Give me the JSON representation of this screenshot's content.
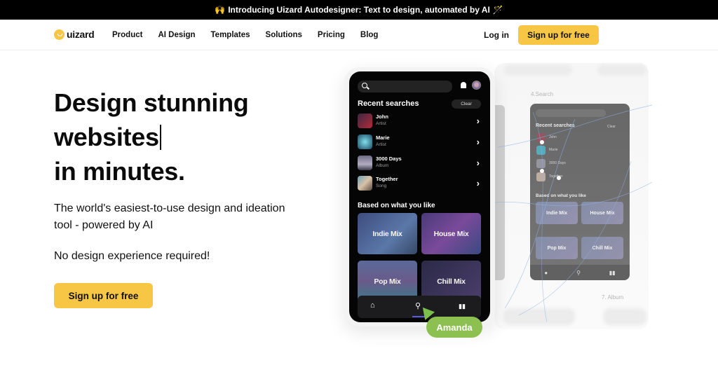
{
  "announcement": {
    "leading_emoji": "🙌",
    "text": "Introducing Uizard Autodesigner: Text to design, automated by AI",
    "trailing_emoji": "🪄"
  },
  "nav": {
    "logo_text": "uizard",
    "links": [
      "Product",
      "AI Design",
      "Templates",
      "Solutions",
      "Pricing",
      "Blog"
    ],
    "login_label": "Log in",
    "cta_label": "Sign up for free"
  },
  "hero": {
    "title_lines": [
      "Design stunning",
      "websites",
      "in minutes."
    ],
    "subtitle": "The world's easiest-to-use design and ideation tool - powered by AI",
    "note": "No design experience required!",
    "cta_label": "Sign up for free"
  },
  "colors": {
    "accent_yellow": "#f6c644",
    "cursor_green": "#8cc152",
    "announcement_bg": "#000000"
  },
  "phone": {
    "search_placeholder": "",
    "recent_title": "Recent searches",
    "clear_label": "Clear",
    "recent_items": [
      {
        "name": "John",
        "type": "Artist"
      },
      {
        "name": "Marie",
        "type": "Artist"
      },
      {
        "name": "3000 Days",
        "type": "Album"
      },
      {
        "name": "Together",
        "type": "Song"
      }
    ],
    "based_title": "Based on what you like",
    "mixes": [
      "Indie Mix",
      "House Mix",
      "Pop Mix",
      "Chill Mix"
    ],
    "tabs": {
      "home": "⌂",
      "search": "⚲",
      "library": "▮▮"
    },
    "cursor_label": "Amanda"
  },
  "ghost": {
    "screen_label_top": "4.Search",
    "screen_label_bottom": "7. Album",
    "recent_title": "Recent searches",
    "clear_label": "Clear",
    "recent_items": [
      "John",
      "Marie",
      "3000 Days",
      "Together"
    ],
    "based_title": "Based on what you like",
    "mixes": [
      "Indie Mix",
      "House Mix",
      "Pop Mix",
      "Chill Mix"
    ]
  }
}
